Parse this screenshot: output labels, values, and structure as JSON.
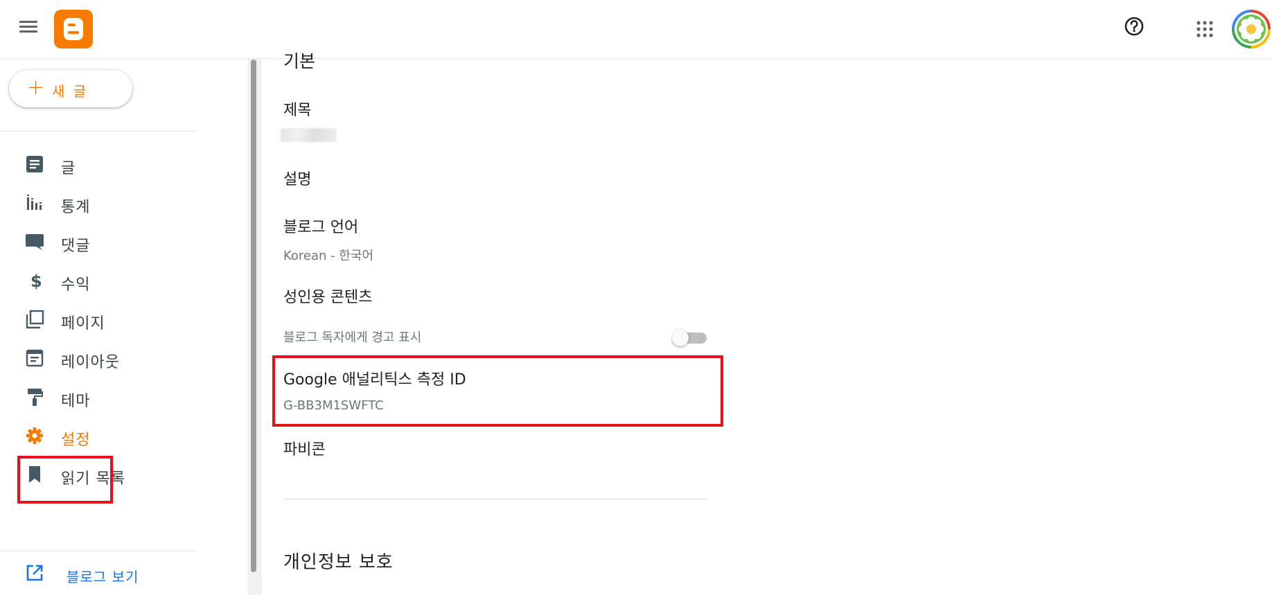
{
  "header": {
    "menu_icon": "menu-icon",
    "logo_icon": "blogger-logo",
    "help_icon": "help-circle-icon",
    "apps_icon": "apps-grid-icon",
    "avatar_icon": "flower-avatar"
  },
  "sidebar": {
    "new_post": {
      "plus": "+",
      "label": "새 글"
    },
    "items": [
      {
        "label": "글",
        "icon": "posts-icon"
      },
      {
        "label": "통계",
        "icon": "stats-icon"
      },
      {
        "label": "댓글",
        "icon": "comments-icon"
      },
      {
        "label": "수익",
        "icon": "dollar-icon"
      },
      {
        "label": "페이지",
        "icon": "pages-icon"
      },
      {
        "label": "레이아웃",
        "icon": "layout-icon"
      },
      {
        "label": "테마",
        "icon": "theme-roller-icon"
      },
      {
        "label": "설정",
        "icon": "gear-icon"
      },
      {
        "label": "읽기 목록",
        "icon": "bookmark-icon"
      }
    ],
    "view_blog": {
      "label": "블로그 보기",
      "icon": "open-external-icon"
    }
  },
  "main": {
    "section_basic_cut": "기본",
    "fields": {
      "title_label": "제목",
      "description_label": "설명",
      "language_label": "블로그 언어",
      "language_value": "Korean - 한국어",
      "adult_label": "성인용 콘텐츠",
      "adult_desc": "블로그 독자에게 경고 표시",
      "adult_toggle_on": false,
      "ga_label": "Google 애널리틱스 측정 ID",
      "ga_value": "G-BB3M1SWFTC",
      "favicon_label": "파비콘"
    },
    "section_privacy": "개인정보 보호"
  },
  "colors": {
    "accent": "#f57c00",
    "highlight_box": "#e8101a",
    "link": "#1a73e8",
    "icon_gray": "#455a64"
  }
}
